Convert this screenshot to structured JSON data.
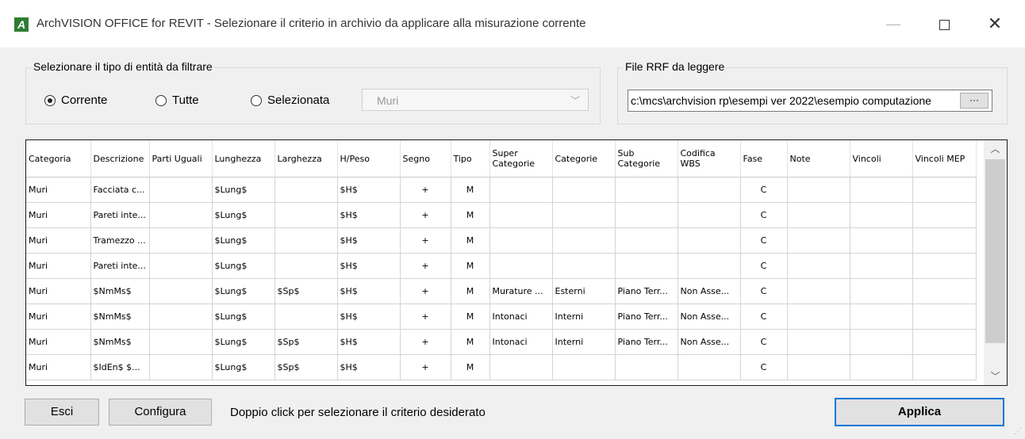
{
  "window": {
    "title": "ArchVISION OFFICE for REVIT - Selezionare il criterio in archivio da applicare alla misurazione corrente",
    "app_icon_letter": "A",
    "minimize": "—",
    "close": "✕"
  },
  "filter_group": {
    "legend": "Selezionare il tipo di entità da filtrare",
    "radios": [
      {
        "label": "Corrente",
        "checked": true
      },
      {
        "label": "Tutte",
        "checked": false
      },
      {
        "label": "Selezionata",
        "checked": false
      }
    ],
    "combo_value": "Muri",
    "combo_arrow": "﹀"
  },
  "file_group": {
    "legend": "File RRF da leggere",
    "path_value": "c:\\mcs\\archvision rp\\esempi ver 2022\\esempio computazione",
    "browse_label": "···"
  },
  "grid": {
    "columns": [
      "Categoria",
      "Descrizione",
      "Parti Uguali",
      "Lunghezza",
      "Larghezza",
      "H/Peso",
      "Segno",
      "Tipo",
      "Super Categorie",
      "Categorie",
      "Sub Categorie",
      "Codifica WBS",
      "Fase",
      "Note",
      "Vincoli",
      "Vincoli MEP"
    ],
    "rows": [
      [
        "Muri",
        "Facciata c...",
        "",
        "$Lung$",
        "",
        "$H$",
        "+",
        "M",
        "",
        "",
        "",
        "",
        "C",
        "",
        "",
        ""
      ],
      [
        "Muri",
        "Pareti inte...",
        "",
        "$Lung$",
        "",
        "$H$",
        "+",
        "M",
        "",
        "",
        "",
        "",
        "C",
        "",
        "",
        ""
      ],
      [
        "Muri",
        "Tramezzo ...",
        "",
        "$Lung$",
        "",
        "$H$",
        "+",
        "M",
        "",
        "",
        "",
        "",
        "C",
        "",
        "",
        ""
      ],
      [
        "Muri",
        "Pareti inte...",
        "",
        "$Lung$",
        "",
        "$H$",
        "+",
        "M",
        "",
        "",
        "",
        "",
        "C",
        "",
        "",
        ""
      ],
      [
        "Muri",
        "$NmMs$",
        "",
        "$Lung$",
        "$Sp$",
        "$H$",
        "+",
        "M",
        "Murature ...",
        "Esterni",
        "Piano Terr...",
        "Non Asse...",
        "C",
        "",
        "",
        ""
      ],
      [
        "Muri",
        "$NmMs$",
        "",
        "$Lung$",
        "",
        "$H$",
        "+",
        "M",
        "Intonaci",
        "Interni",
        "Piano Terr...",
        "Non Asse...",
        "C",
        "",
        "",
        ""
      ],
      [
        "Muri",
        "$NmMs$",
        "",
        "$Lung$",
        "$Sp$",
        "$H$",
        "+",
        "M",
        "Intonaci",
        "Interni",
        "Piano Terr...",
        "Non Asse...",
        "C",
        "",
        "",
        ""
      ],
      [
        "Muri",
        "$IdEn$ $...",
        "",
        "$Lung$",
        "$Sp$",
        "$H$",
        "+",
        "M",
        "",
        "",
        "",
        "",
        "C",
        "",
        "",
        ""
      ]
    ],
    "scroll_up": "︿",
    "scroll_down": "﹀"
  },
  "footer": {
    "esci_label": "Esci",
    "configura_label": "Configura",
    "hint": "Doppio click per selezionare il criterio desiderato",
    "applica_label": "Applica"
  },
  "colors": {
    "accent": "#0078d7",
    "app_icon": "#2e7d32"
  }
}
